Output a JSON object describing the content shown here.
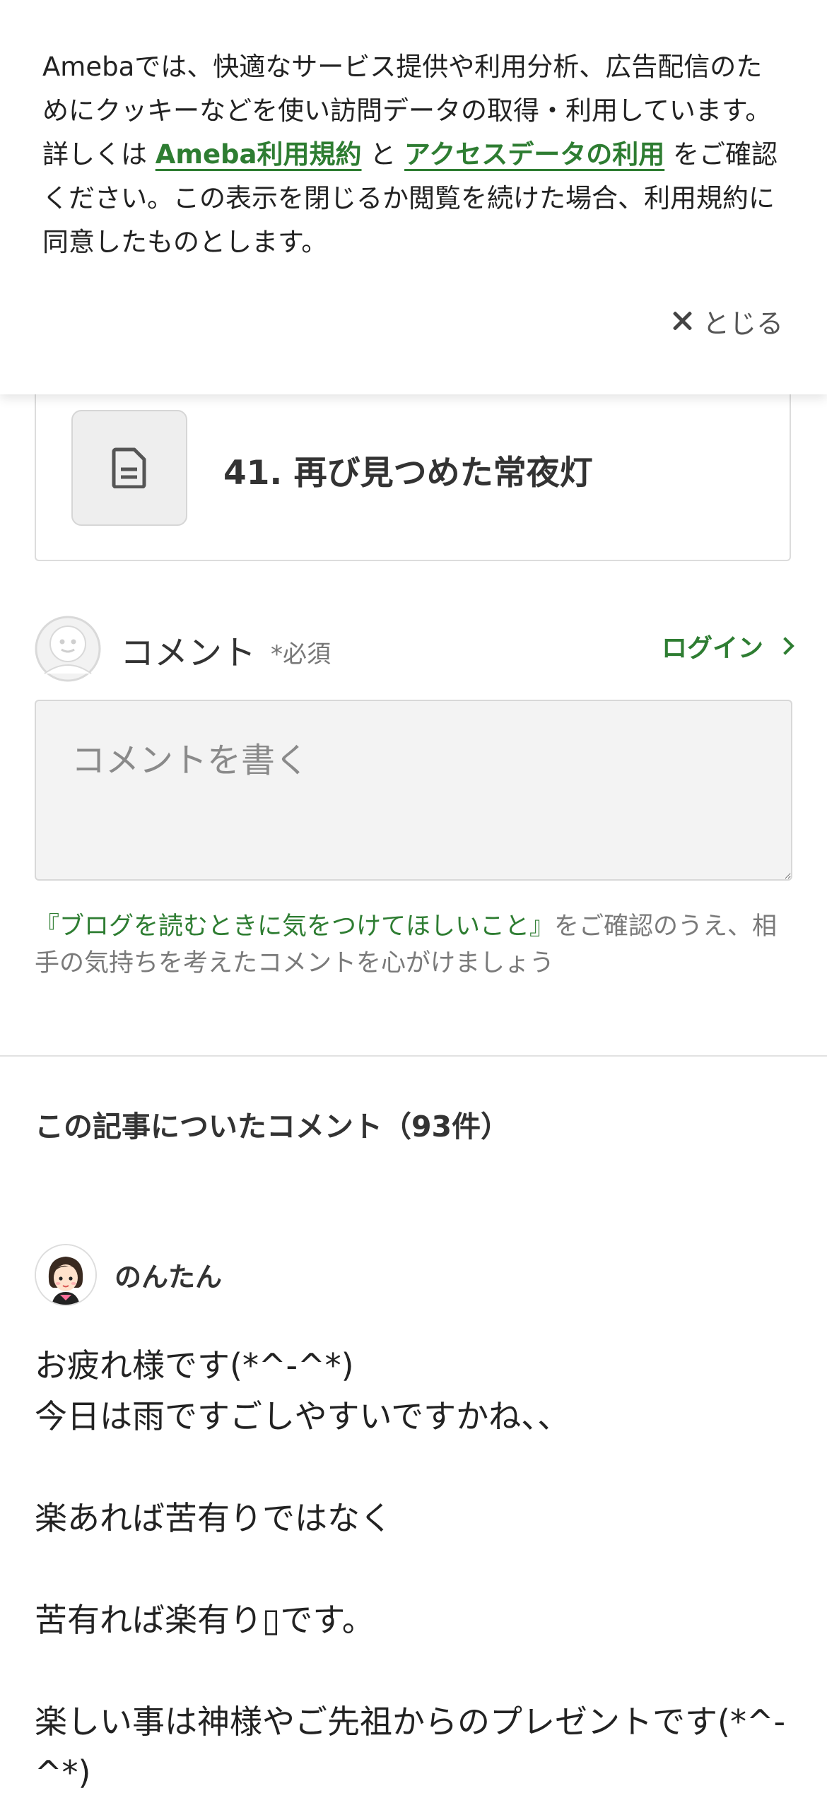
{
  "cookie_banner": {
    "text_before": "Amebaでは、快適なサービス提供や利用分析、広告配信のためにクッキーなどを使い訪問データの取得・利用しています。詳しくは ",
    "terms_link": "Ameba利用規約",
    "middle": " と ",
    "access_link": "アクセスデータの利用",
    "text_after": " をご確認ください。この表示を閉じるか閲覧を続けた場合、利用規約に同意したものとします。",
    "close_label": "とじる"
  },
  "related_article": {
    "title": "41. 再び見つめた常夜灯",
    "icon": "document-icon"
  },
  "comment_form": {
    "label": "コメント",
    "required": "*必須",
    "login_label": "ログイン",
    "placeholder": "コメントを書く",
    "guideline_link": "『ブログを読むときに気をつけてほしいこと』",
    "guideline_rest": "をご確認のうえ、相手の気持ちを考えたコメントを心がけましょう"
  },
  "comments": {
    "heading": "この記事についたコメント（93件）",
    "items": [
      {
        "author": "のんたん",
        "body": "お疲れ様です(*^-^*)\n今日は雨ですごしやすいですかね、、\n\n楽あれば苦有りではなく\n\n苦有れば楽有り▯です。\n\n楽しい事は神様やご先祖からのプレゼントです(*^-^*)"
      }
    ]
  },
  "colors": {
    "accent_green": "#2e7d32",
    "text": "#333333",
    "muted": "#7a7a7a",
    "box_bg": "#f3f3f3"
  }
}
